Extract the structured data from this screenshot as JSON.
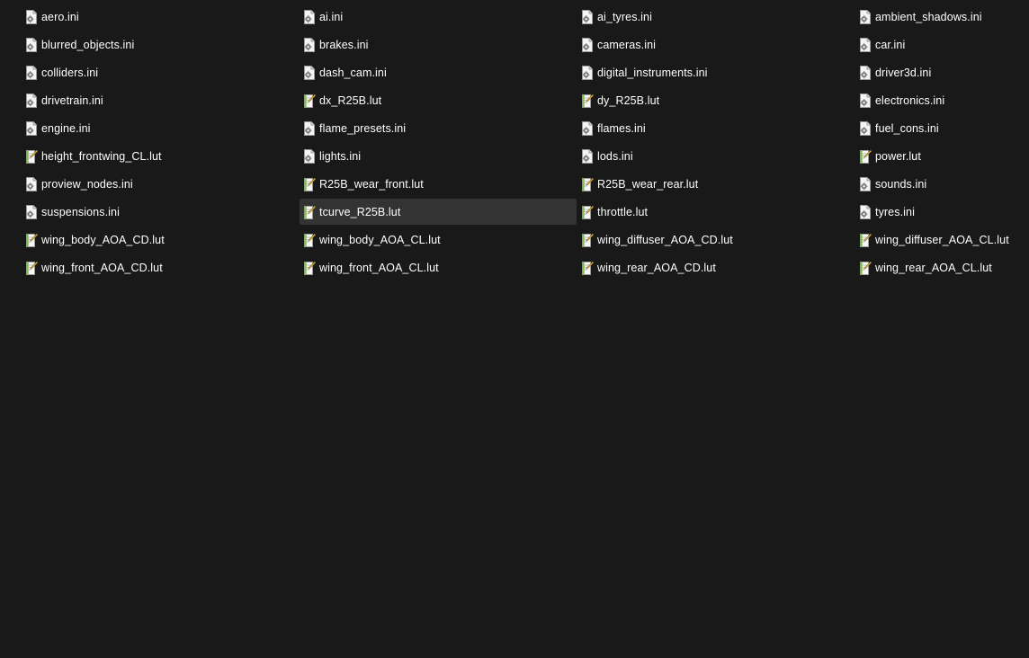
{
  "colors": {
    "background": "#191919",
    "text": "#ffffff",
    "selection": "#333333",
    "lut_icon_accent": "#6fb33a"
  },
  "selected_file": "tcurve_R25B.lut",
  "files": [
    {
      "name": "aero.ini",
      "icon": "settings-file-icon"
    },
    {
      "name": "ai.ini",
      "icon": "settings-file-icon"
    },
    {
      "name": "ai_tyres.ini",
      "icon": "settings-file-icon"
    },
    {
      "name": "ambient_shadows.ini",
      "icon": "settings-file-icon"
    },
    {
      "name": "blurred_objects.ini",
      "icon": "settings-file-icon"
    },
    {
      "name": "brakes.ini",
      "icon": "settings-file-icon"
    },
    {
      "name": "cameras.ini",
      "icon": "settings-file-icon"
    },
    {
      "name": "car.ini",
      "icon": "settings-file-icon"
    },
    {
      "name": "colliders.ini",
      "icon": "settings-file-icon"
    },
    {
      "name": "dash_cam.ini",
      "icon": "settings-file-icon"
    },
    {
      "name": "digital_instruments.ini",
      "icon": "settings-file-icon"
    },
    {
      "name": "driver3d.ini",
      "icon": "settings-file-icon"
    },
    {
      "name": "drivetrain.ini",
      "icon": "settings-file-icon"
    },
    {
      "name": "dx_R25B.lut",
      "icon": "text-file-icon"
    },
    {
      "name": "dy_R25B.lut",
      "icon": "text-file-icon"
    },
    {
      "name": "electronics.ini",
      "icon": "settings-file-icon"
    },
    {
      "name": "engine.ini",
      "icon": "settings-file-icon"
    },
    {
      "name": "flame_presets.ini",
      "icon": "settings-file-icon"
    },
    {
      "name": "flames.ini",
      "icon": "settings-file-icon"
    },
    {
      "name": "fuel_cons.ini",
      "icon": "settings-file-icon"
    },
    {
      "name": "height_frontwing_CL.lut",
      "icon": "text-file-icon"
    },
    {
      "name": "lights.ini",
      "icon": "settings-file-icon"
    },
    {
      "name": "lods.ini",
      "icon": "settings-file-icon"
    },
    {
      "name": "power.lut",
      "icon": "text-file-icon"
    },
    {
      "name": "proview_nodes.ini",
      "icon": "settings-file-icon"
    },
    {
      "name": "R25B_wear_front.lut",
      "icon": "text-file-icon"
    },
    {
      "name": "R25B_wear_rear.lut",
      "icon": "text-file-icon"
    },
    {
      "name": "sounds.ini",
      "icon": "settings-file-icon"
    },
    {
      "name": "suspensions.ini",
      "icon": "settings-file-icon"
    },
    {
      "name": "tcurve_R25B.lut",
      "icon": "text-file-icon"
    },
    {
      "name": "throttle.lut",
      "icon": "text-file-icon"
    },
    {
      "name": "tyres.ini",
      "icon": "settings-file-icon"
    },
    {
      "name": "wing_body_AOA_CD.lut",
      "icon": "text-file-icon"
    },
    {
      "name": "wing_body_AOA_CL.lut",
      "icon": "text-file-icon"
    },
    {
      "name": "wing_diffuser_AOA_CD.lut",
      "icon": "text-file-icon"
    },
    {
      "name": "wing_diffuser_AOA_CL.lut",
      "icon": "text-file-icon"
    },
    {
      "name": "wing_front_AOA_CD.lut",
      "icon": "text-file-icon"
    },
    {
      "name": "wing_front_AOA_CL.lut",
      "icon": "text-file-icon"
    },
    {
      "name": "wing_rear_AOA_CD.lut",
      "icon": "text-file-icon"
    },
    {
      "name": "wing_rear_AOA_CL.lut",
      "icon": "text-file-icon"
    }
  ]
}
